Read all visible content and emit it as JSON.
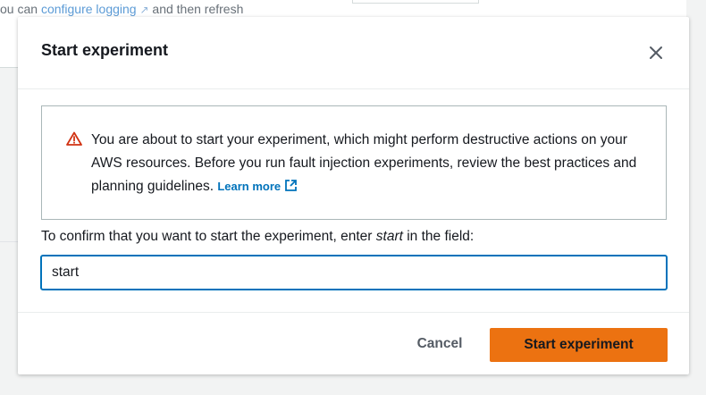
{
  "background": {
    "text_prefix": "ou can ",
    "link_label": "configure logging",
    "text_suffix": " and then refresh"
  },
  "modal": {
    "title": "Start experiment",
    "close_icon": "close-icon",
    "alert": {
      "icon": "warning-icon",
      "message": "You are about to start your experiment, which might perform destructive actions on your AWS resources. Before you run fault injection experiments, review the best practices and planning guidelines.",
      "learn_more_label": "Learn more",
      "learn_more_icon": "external-link-icon"
    },
    "confirm": {
      "label_prefix": "To confirm that you want to start the experiment, enter ",
      "label_keyword": "start",
      "label_suffix": " in the field:",
      "input_value": "start"
    },
    "footer": {
      "cancel_label": "Cancel",
      "start_label": "Start experiment"
    }
  },
  "colors": {
    "accent": "#ec7211",
    "link": "#0073bb",
    "warning": "#d13212",
    "focus": "#0073bb"
  }
}
